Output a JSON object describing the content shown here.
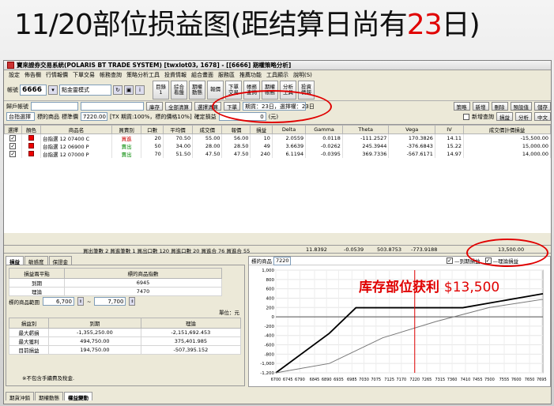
{
  "slide_title_pre": "11/20部位损益图(距结算日尚有",
  "slide_title_days": "23",
  "slide_title_post": "日)",
  "window_title": "寶來證券交易系統(POLARIS BT TRADE SYSTEM)  [twxlot03, 1678] - [[6666] 期權策略分析]",
  "menu": [
    "設定",
    "佈告欄",
    "行情報價",
    "下單交易",
    "帳務查詢",
    "策略分析工具",
    "投資情報",
    "組合畫面",
    "服務區",
    "推薦功能",
    "工具顯示",
    "說明(S)"
  ],
  "account": "6666",
  "strategy_mode": "點金靈模式",
  "toolbar_buttons": [
    "目錄\n1",
    "綜合\n看盤",
    "期權\n動態",
    "報價",
    "下單\n交易",
    "帳務\n查詢",
    "期權\n帳務",
    "分析\n工具",
    "投資\n情報"
  ],
  "row2": {
    "label": "歸戶帳號",
    "btns": [
      "庫存",
      "全部清算",
      "選擇清算",
      "下單"
    ],
    "expiry_info": "期貨：23日，選擇權：23日",
    "right_btns": [
      "策略",
      "新增",
      "刪除",
      "預設值",
      "儲存"
    ]
  },
  "row3": {
    "underlying": "台指選擇",
    "underlying_label": "標的商品",
    "price_label": "標準價",
    "price": "7220.00",
    "note": "[TX 期貨:100%，標的價格10%]",
    "fee_label": "確定損益",
    "fee": "0",
    "unit": "(元)",
    "new_query": "新增查詢",
    "right_btns": [
      "損益",
      "分析",
      "中文"
    ]
  },
  "table": {
    "headers": [
      "選擇",
      "顏色",
      "商品名",
      "買賣別",
      "口數",
      "平均價",
      "成交價",
      "報價",
      "損益",
      "Delta",
      "Gamma",
      "Theta",
      "Vega",
      "IV",
      "成交價計價損益"
    ],
    "rows": [
      {
        "name": "台指選 12 07400 C",
        "side": "買進",
        "qty": "20",
        "avg": "70.50",
        "fill": "55.00",
        "quote": "56.00",
        "pnl": "10",
        "delta": "2.0559",
        "gamma": "0.0118",
        "theta": "-111.2527",
        "vega": "170.3826",
        "iv": "14.11",
        "total": "-15,500.00"
      },
      {
        "name": "台指選 12 06900 P",
        "side": "賣出",
        "qty": "50",
        "avg": "34.00",
        "fill": "28.00",
        "quote": "28.50",
        "pnl": "49",
        "delta": "3.6639",
        "gamma": "-0.0262",
        "theta": "245.3944",
        "vega": "-376.6843",
        "iv": "15.22",
        "total": "15,000.00"
      },
      {
        "name": "台指選 12 07000 P",
        "side": "賣出",
        "qty": "70",
        "avg": "51.50",
        "fill": "47.50",
        "quote": "47.50",
        "pnl": "240",
        "delta": "6.1194",
        "gamma": "-0.0395",
        "theta": "369.7336",
        "vega": "-567.6171",
        "iv": "14.97",
        "total": "14,000.00"
      }
    ]
  },
  "summary": {
    "text": "買出筆數 2 買進筆數 1 買出口數 120 買進口數 20 買進合 76 買進合 55",
    "delta": "11.8392",
    "gamma": "-0.0539",
    "theta": "503.8753",
    "vega": "-773.9188",
    "total": "13,500.00"
  },
  "left_tabs": [
    "損益",
    "敏感度",
    "保證金"
  ],
  "left": {
    "target_header": [
      "損益兩平點",
      "標的商品指數"
    ],
    "target_rows": [
      [
        "到期",
        "6945"
      ],
      [
        "理論",
        "7470"
      ]
    ],
    "range_label": "標的商品範圍",
    "range_from": "6,700",
    "range_to": "7,700",
    "unit_label": "單位：元",
    "pnl_header": [
      "損益別",
      "到期",
      "理論"
    ],
    "pnl_rows": [
      [
        "最大虧損",
        "-1,355,250.00",
        "-2,151,692.453"
      ],
      [
        "最大獲利",
        "494,750.00",
        "375,401.985"
      ],
      [
        "目前損益",
        "194,750.00",
        "-507,395.152"
      ]
    ],
    "footnote": "※不包含手續費及稅金."
  },
  "chart_head": {
    "label": "標的商品",
    "value": "7220",
    "legend_expiry": "到期損益",
    "legend_theory": "理論損益"
  },
  "overlay_label": "库存部位获利",
  "overlay_amount": "$13,500",
  "bottom_tabs": [
    "期貨沖銷",
    "期權動態",
    "權益變動"
  ],
  "chart_data": {
    "type": "line",
    "x_ticks": [
      6700,
      6745,
      6790,
      6845,
      6890,
      6935,
      6985,
      7030,
      7075,
      7125,
      7170,
      7220,
      7265,
      7315,
      7360,
      7410,
      7455,
      7500,
      7555,
      7600,
      7650,
      7695
    ],
    "y_ticks": [
      1000,
      800,
      600,
      400,
      200,
      0,
      -200,
      -400,
      -600,
      -800,
      -1000,
      -1200
    ],
    "xlim": [
      6700,
      7700
    ],
    "ylim": [
      -1200,
      1000
    ],
    "current_price": 7220,
    "series": [
      {
        "name": "到期損益",
        "color": "#000000",
        "x": [
          6700,
          6900,
          7000,
          7400,
          7700
        ],
        "y": [
          -1355,
          -355,
          195,
          195,
          495
        ]
      },
      {
        "name": "理論損益",
        "color": "#777777",
        "x": [
          6700,
          6900,
          7100,
          7300,
          7500,
          7700
        ],
        "y": [
          -2150,
          -1000,
          -450,
          -100,
          200,
          375
        ]
      }
    ]
  }
}
